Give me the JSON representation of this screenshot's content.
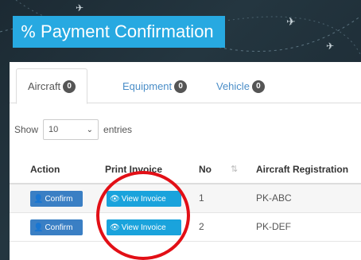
{
  "header": {
    "title": "Payment Confirmation",
    "title_icon": "percent-icon"
  },
  "tabs": [
    {
      "label": "Aircraft",
      "count": "0",
      "active": true
    },
    {
      "label": "Equipment",
      "count": "0",
      "active": false
    },
    {
      "label": "Vehicle",
      "count": "0",
      "active": false
    }
  ],
  "entries": {
    "prefix": "Show",
    "value": "10",
    "suffix": "entries"
  },
  "table": {
    "headers": [
      "Action",
      "Print Invoice",
      "No",
      "Aircraft Registration"
    ],
    "sort_icon": "sort-icon",
    "rows": [
      {
        "confirm_label": "Confirm",
        "invoice_label": "View Invoice",
        "no": "1",
        "registration": "PK-ABC"
      },
      {
        "confirm_label": "Confirm",
        "invoice_label": "View Invoice",
        "no": "2",
        "registration": "PK-DEF"
      }
    ]
  },
  "colors": {
    "accent": "#27a9e1",
    "confirm": "#3a7fc4",
    "view": "#1aa3dc",
    "highlight_circle": "#e20f16"
  }
}
